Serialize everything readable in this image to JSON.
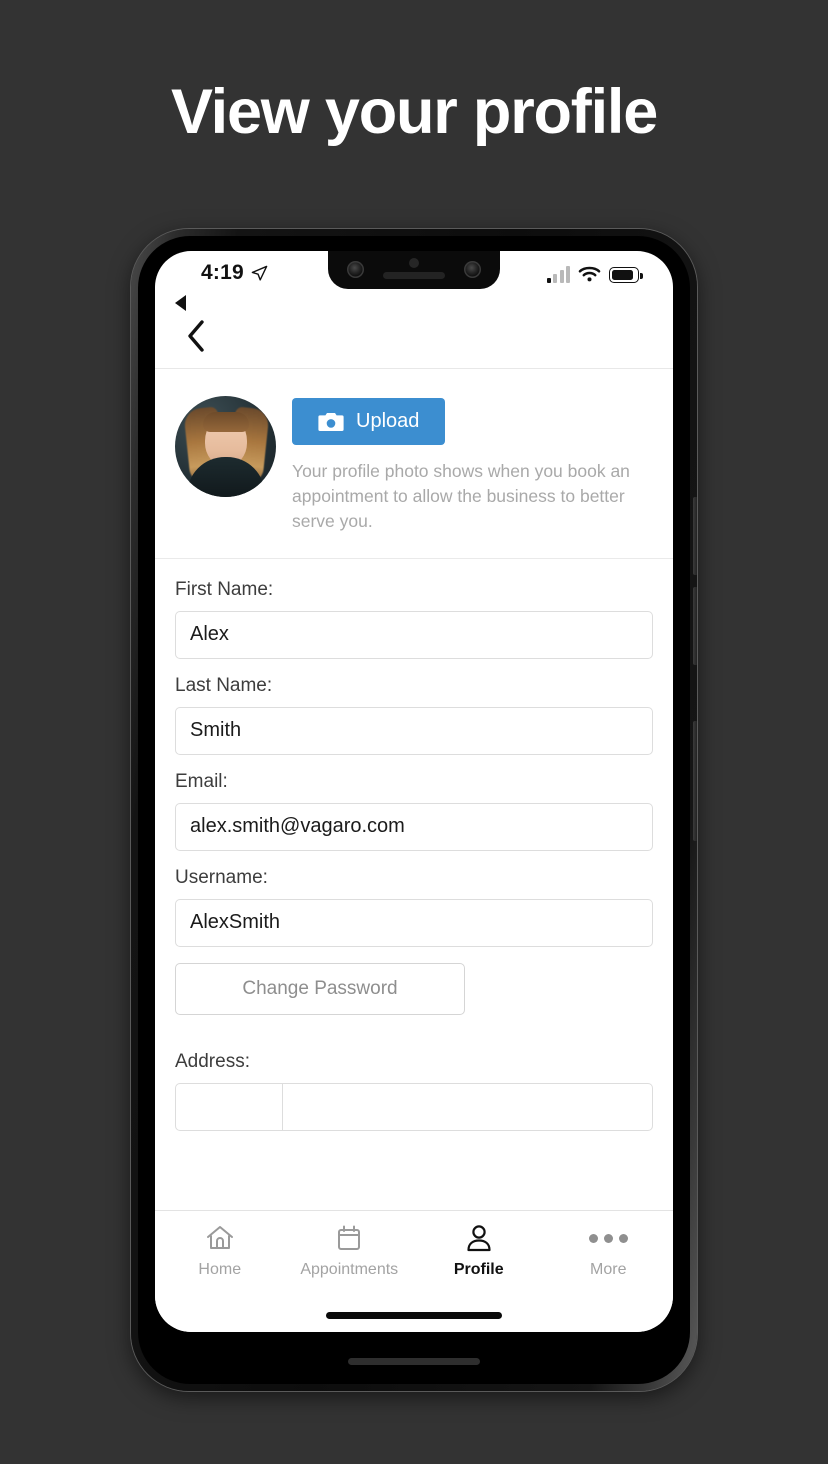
{
  "headline": "View your profile",
  "statusbar": {
    "time": "4:19",
    "location_icon": "location-arrow-icon",
    "back_indicator_icon": "back-triangle-icon",
    "signal_icon": "cellular-signal-icon",
    "wifi_icon": "wifi-icon",
    "battery_icon": "battery-icon"
  },
  "navbar": {
    "back_icon": "back-chevron-icon"
  },
  "photo_section": {
    "avatar_name": "profile-avatar",
    "upload_label": "Upload",
    "camera_icon": "camera-icon",
    "hint": "Your profile photo shows when you book an appointment to allow the business to better serve you."
  },
  "form": {
    "fields": [
      {
        "label": "First Name:",
        "value": "Alex"
      },
      {
        "label": "Last Name:",
        "value": "Smith"
      },
      {
        "label": "Email:",
        "value": "alex.smith@vagaro.com"
      },
      {
        "label": "Username:",
        "value": "AlexSmith"
      }
    ],
    "change_password_label": "Change Password",
    "address_label": "Address:",
    "address_small_value": "",
    "address_large_value": ""
  },
  "tabbar": {
    "tabs": [
      {
        "label": "Home",
        "icon": "home-icon",
        "active": false
      },
      {
        "label": "Appointments",
        "icon": "calendar-icon",
        "active": false
      },
      {
        "label": "Profile",
        "icon": "person-icon",
        "active": true
      },
      {
        "label": "More",
        "icon": "more-dots-icon",
        "active": false
      }
    ]
  },
  "colors": {
    "background": "#333333",
    "accent_blue": "#3c8ed0",
    "screen_white": "#ffffff",
    "label_gray": "#a9a9a9"
  }
}
